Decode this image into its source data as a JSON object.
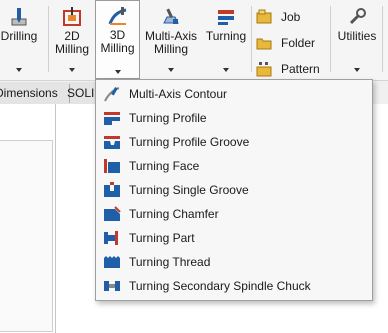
{
  "ribbon": {
    "buttons": [
      {
        "label_lines": [
          "Drilling"
        ],
        "icon": "drilling-icon",
        "arrow": true
      },
      {
        "label_lines": [
          "2D",
          "Milling"
        ],
        "icon": "milling-2d-icon",
        "arrow": true
      },
      {
        "label_lines": [
          "3D",
          "Milling"
        ],
        "icon": "milling-3d-icon",
        "arrow": true
      },
      {
        "label_lines": [
          "Multi-Axis",
          "Milling"
        ],
        "icon": "multi-axis-milling-icon",
        "arrow": true
      },
      {
        "label_lines": [
          "Turning"
        ],
        "icon": "turning-icon",
        "arrow": true
      },
      {
        "label_lines": [
          "Utilities"
        ],
        "icon": "utilities-icon",
        "arrow": true
      }
    ],
    "small_items": [
      {
        "label": "Job",
        "icon": "job-icon"
      },
      {
        "label": "Folder",
        "icon": "folder-icon"
      },
      {
        "label": "Pattern",
        "icon": "pattern-icon"
      }
    ]
  },
  "tabs": [
    {
      "label": "Dimensions"
    },
    {
      "label": "SOLIDWORKS"
    }
  ],
  "menu": {
    "items": [
      {
        "label": "Multi-Axis Contour",
        "icon": "multi-axis-contour-icon"
      },
      {
        "label": "Turning Profile",
        "icon": "turning-profile-icon"
      },
      {
        "label": "Turning Profile Groove",
        "icon": "turning-profile-groove-icon"
      },
      {
        "label": "Turning Face",
        "icon": "turning-face-icon"
      },
      {
        "label": "Turning Single Groove",
        "icon": "turning-single-groove-icon"
      },
      {
        "label": "Turning Chamfer",
        "icon": "turning-chamfer-icon"
      },
      {
        "label": "Turning Part",
        "icon": "turning-part-icon"
      },
      {
        "label": "Turning Thread",
        "icon": "turning-thread-icon"
      },
      {
        "label": "Turning Secondary Spindle Chuck",
        "icon": "turning-secondary-spindle-chuck-icon"
      }
    ]
  },
  "colors": {
    "accent_blue": "#1f5fa8",
    "accent_orange": "#e8862a",
    "accent_red": "#c0392b",
    "folder_yellow": "#e9b73a"
  }
}
